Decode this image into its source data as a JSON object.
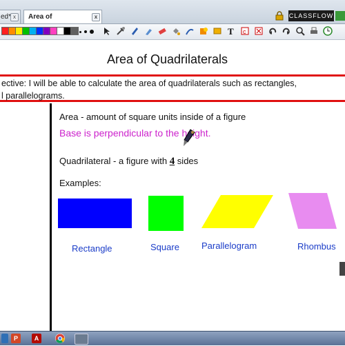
{
  "tabs": [
    {
      "label": "ed*",
      "close": "x"
    },
    {
      "label": "Area of Quadrilaterals*",
      "close": "x"
    }
  ],
  "brand": {
    "label": "CLASSFLOW"
  },
  "toolbar": {
    "swatches": [
      "#ff2020",
      "#ff8c00",
      "#ffee00",
      "#00c000",
      "#00b0f0",
      "#0030ff",
      "#8000c0",
      "#ff40c0",
      "#ffffff",
      "#000000",
      "#606060"
    ],
    "icons": [
      "select-icon",
      "tools-icon",
      "pen-icon",
      "highlighter-icon",
      "eraser-icon",
      "fill-icon",
      "connector-icon",
      "shapes-icon",
      "note-icon",
      "text-icon",
      "copy-icon",
      "delete-icon",
      "undo-icon",
      "redo-icon",
      "zoom-icon",
      "print-icon",
      "clock-icon"
    ]
  },
  "page": {
    "title": "Area of Quadrilaterals",
    "objective_line1": "ective: I will be able to calculate the area of quadrilaterals such as rectangles,",
    "objective_line2": "l parallelograms.",
    "area_definition": "Area - amount of square units inside of a figure",
    "base_note": "Base is perpendicular to the height.",
    "quad_prefix": "Quadrilateral - a figure with ",
    "quad_number": "4",
    "quad_suffix": " sides",
    "examples_label": "Examples:",
    "shapes": [
      {
        "name": "Rectangle",
        "color": "#0000ff"
      },
      {
        "name": "Square",
        "color": "#00ff00"
      },
      {
        "name": "Parallelogram",
        "color": "#ffff00"
      },
      {
        "name": "Rhombus",
        "color": "#e88cf0"
      }
    ]
  },
  "taskbar": {
    "icons": [
      "powerpoint-icon",
      "acrobat-icon",
      "chrome-icon",
      "activinspire-icon"
    ]
  }
}
